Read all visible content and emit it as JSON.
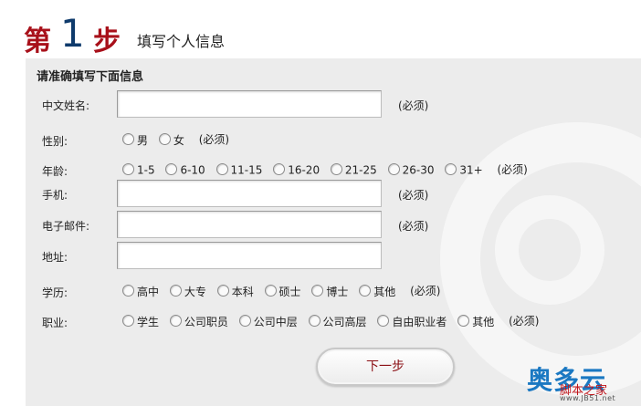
{
  "header": {
    "step_prefix": "第",
    "step_number": "1",
    "step_suffix": "步",
    "subtitle": "填写个人信息"
  },
  "form": {
    "section_title": "请准确填写下面信息",
    "required_text": "(必须)",
    "fields": {
      "name": {
        "label": "中文姓名:",
        "value": ""
      },
      "gender": {
        "label": "性别:",
        "options": [
          "男",
          "女"
        ]
      },
      "age": {
        "label": "年龄:",
        "options": [
          "1-5",
          "6-10",
          "11-15",
          "16-20",
          "21-25",
          "26-30",
          "31+"
        ]
      },
      "mobile": {
        "label": "手机:",
        "value": ""
      },
      "email": {
        "label": "电子邮件:",
        "value": ""
      },
      "address": {
        "label": "地址:",
        "value": ""
      },
      "education": {
        "label": "学历:",
        "options": [
          "高中",
          "大专",
          "本科",
          "硕士",
          "博士",
          "其他"
        ]
      },
      "occupation": {
        "label": "职业:",
        "options": [
          "学生",
          "公司职员",
          "公司中层",
          "公司高层",
          "自由职业者",
          "其他"
        ]
      }
    },
    "next_button": "下一步"
  },
  "brand": {
    "main": "奥多云",
    "sub": "脚本之家",
    "url": "www.JB51.net"
  },
  "colors": {
    "step_red": "#a8101a",
    "step_blue": "#0e3a6b",
    "panel_bg": "#ececec",
    "button_text": "#8a0f14"
  }
}
